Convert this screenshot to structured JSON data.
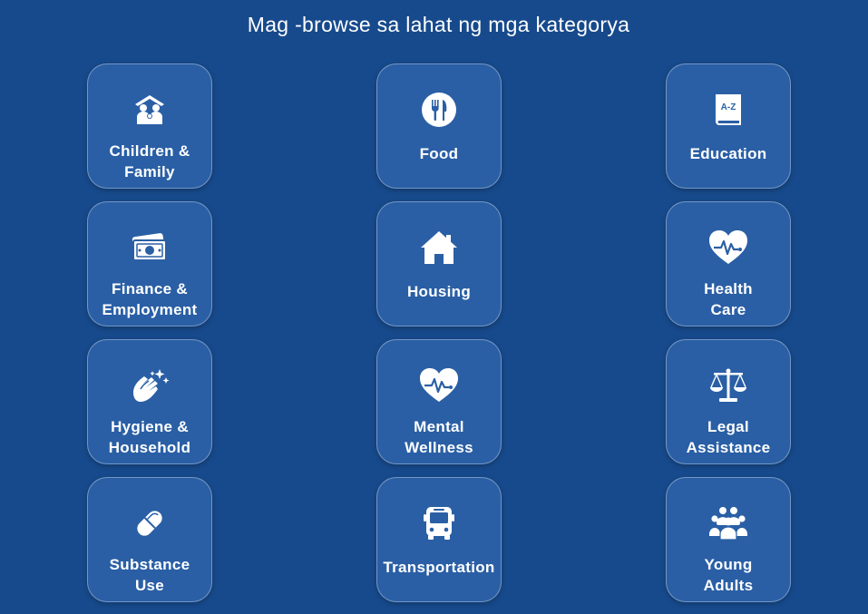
{
  "header": {
    "title": "Mag -browse sa lahat ng mga kategorya"
  },
  "categories": [
    {
      "label": "Children &\nFamily",
      "icon": "children-family-icon"
    },
    {
      "label": "Food",
      "icon": "food-icon"
    },
    {
      "label": "Education",
      "icon": "education-icon",
      "icon_text": "A-Z"
    },
    {
      "label": "Finance &\nEmployment",
      "icon": "money-icon"
    },
    {
      "label": "Housing",
      "icon": "house-icon"
    },
    {
      "label": "Health\nCare",
      "icon": "heart-pulse-icon"
    },
    {
      "label": "Hygiene &\nHousehold",
      "icon": "hygiene-hands-icon"
    },
    {
      "label": "Mental\nWellness",
      "icon": "heart-pulse-icon"
    },
    {
      "label": "Legal\nAssistance",
      "icon": "scales-icon"
    },
    {
      "label": "Substance\nUse",
      "icon": "capsule-icon"
    },
    {
      "label": "Transportation",
      "icon": "bus-icon"
    },
    {
      "label": "Young\nAdults",
      "icon": "group-people-icon"
    }
  ]
}
